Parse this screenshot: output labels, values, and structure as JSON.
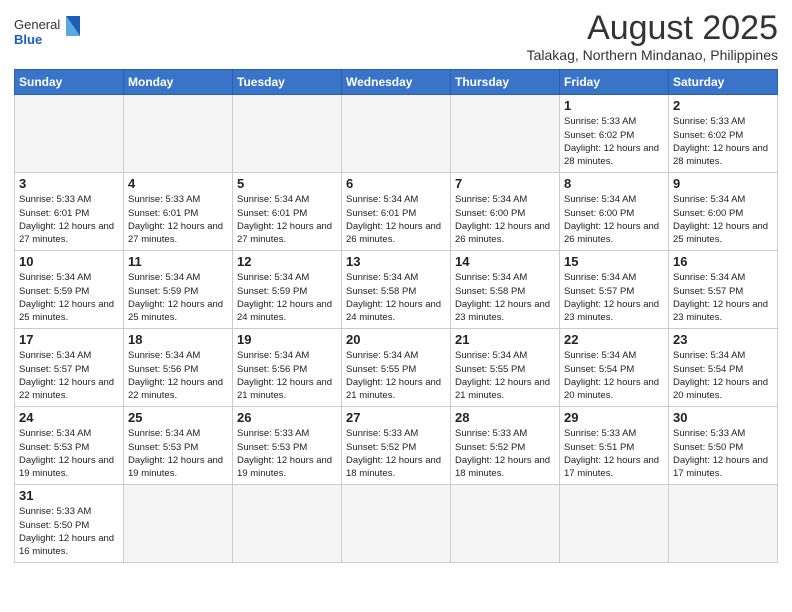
{
  "header": {
    "logo_general": "General",
    "logo_blue": "Blue",
    "month_title": "August 2025",
    "location": "Talakag, Northern Mindanao, Philippines"
  },
  "days_of_week": [
    "Sunday",
    "Monday",
    "Tuesday",
    "Wednesday",
    "Thursday",
    "Friday",
    "Saturday"
  ],
  "weeks": [
    [
      {
        "day": "",
        "info": ""
      },
      {
        "day": "",
        "info": ""
      },
      {
        "day": "",
        "info": ""
      },
      {
        "day": "",
        "info": ""
      },
      {
        "day": "",
        "info": ""
      },
      {
        "day": "1",
        "info": "Sunrise: 5:33 AM\nSunset: 6:02 PM\nDaylight: 12 hours\nand 28 minutes."
      },
      {
        "day": "2",
        "info": "Sunrise: 5:33 AM\nSunset: 6:02 PM\nDaylight: 12 hours\nand 28 minutes."
      }
    ],
    [
      {
        "day": "3",
        "info": "Sunrise: 5:33 AM\nSunset: 6:01 PM\nDaylight: 12 hours\nand 27 minutes."
      },
      {
        "day": "4",
        "info": "Sunrise: 5:33 AM\nSunset: 6:01 PM\nDaylight: 12 hours\nand 27 minutes."
      },
      {
        "day": "5",
        "info": "Sunrise: 5:34 AM\nSunset: 6:01 PM\nDaylight: 12 hours\nand 27 minutes."
      },
      {
        "day": "6",
        "info": "Sunrise: 5:34 AM\nSunset: 6:01 PM\nDaylight: 12 hours\nand 26 minutes."
      },
      {
        "day": "7",
        "info": "Sunrise: 5:34 AM\nSunset: 6:00 PM\nDaylight: 12 hours\nand 26 minutes."
      },
      {
        "day": "8",
        "info": "Sunrise: 5:34 AM\nSunset: 6:00 PM\nDaylight: 12 hours\nand 26 minutes."
      },
      {
        "day": "9",
        "info": "Sunrise: 5:34 AM\nSunset: 6:00 PM\nDaylight: 12 hours\nand 25 minutes."
      }
    ],
    [
      {
        "day": "10",
        "info": "Sunrise: 5:34 AM\nSunset: 5:59 PM\nDaylight: 12 hours\nand 25 minutes."
      },
      {
        "day": "11",
        "info": "Sunrise: 5:34 AM\nSunset: 5:59 PM\nDaylight: 12 hours\nand 25 minutes."
      },
      {
        "day": "12",
        "info": "Sunrise: 5:34 AM\nSunset: 5:59 PM\nDaylight: 12 hours\nand 24 minutes."
      },
      {
        "day": "13",
        "info": "Sunrise: 5:34 AM\nSunset: 5:58 PM\nDaylight: 12 hours\nand 24 minutes."
      },
      {
        "day": "14",
        "info": "Sunrise: 5:34 AM\nSunset: 5:58 PM\nDaylight: 12 hours\nand 23 minutes."
      },
      {
        "day": "15",
        "info": "Sunrise: 5:34 AM\nSunset: 5:57 PM\nDaylight: 12 hours\nand 23 minutes."
      },
      {
        "day": "16",
        "info": "Sunrise: 5:34 AM\nSunset: 5:57 PM\nDaylight: 12 hours\nand 23 minutes."
      }
    ],
    [
      {
        "day": "17",
        "info": "Sunrise: 5:34 AM\nSunset: 5:57 PM\nDaylight: 12 hours\nand 22 minutes."
      },
      {
        "day": "18",
        "info": "Sunrise: 5:34 AM\nSunset: 5:56 PM\nDaylight: 12 hours\nand 22 minutes."
      },
      {
        "day": "19",
        "info": "Sunrise: 5:34 AM\nSunset: 5:56 PM\nDaylight: 12 hours\nand 21 minutes."
      },
      {
        "day": "20",
        "info": "Sunrise: 5:34 AM\nSunset: 5:55 PM\nDaylight: 12 hours\nand 21 minutes."
      },
      {
        "day": "21",
        "info": "Sunrise: 5:34 AM\nSunset: 5:55 PM\nDaylight: 12 hours\nand 21 minutes."
      },
      {
        "day": "22",
        "info": "Sunrise: 5:34 AM\nSunset: 5:54 PM\nDaylight: 12 hours\nand 20 minutes."
      },
      {
        "day": "23",
        "info": "Sunrise: 5:34 AM\nSunset: 5:54 PM\nDaylight: 12 hours\nand 20 minutes."
      }
    ],
    [
      {
        "day": "24",
        "info": "Sunrise: 5:34 AM\nSunset: 5:53 PM\nDaylight: 12 hours\nand 19 minutes."
      },
      {
        "day": "25",
        "info": "Sunrise: 5:34 AM\nSunset: 5:53 PM\nDaylight: 12 hours\nand 19 minutes."
      },
      {
        "day": "26",
        "info": "Sunrise: 5:33 AM\nSunset: 5:53 PM\nDaylight: 12 hours\nand 19 minutes."
      },
      {
        "day": "27",
        "info": "Sunrise: 5:33 AM\nSunset: 5:52 PM\nDaylight: 12 hours\nand 18 minutes."
      },
      {
        "day": "28",
        "info": "Sunrise: 5:33 AM\nSunset: 5:52 PM\nDaylight: 12 hours\nand 18 minutes."
      },
      {
        "day": "29",
        "info": "Sunrise: 5:33 AM\nSunset: 5:51 PM\nDaylight: 12 hours\nand 17 minutes."
      },
      {
        "day": "30",
        "info": "Sunrise: 5:33 AM\nSunset: 5:50 PM\nDaylight: 12 hours\nand 17 minutes."
      }
    ],
    [
      {
        "day": "31",
        "info": "Sunrise: 5:33 AM\nSunset: 5:50 PM\nDaylight: 12 hours\nand 16 minutes."
      },
      {
        "day": "",
        "info": ""
      },
      {
        "day": "",
        "info": ""
      },
      {
        "day": "",
        "info": ""
      },
      {
        "day": "",
        "info": ""
      },
      {
        "day": "",
        "info": ""
      },
      {
        "day": "",
        "info": ""
      }
    ]
  ]
}
